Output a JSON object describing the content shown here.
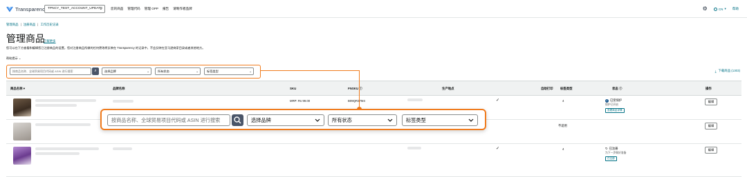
{
  "header": {
    "logo_text": "Transparency",
    "account": "TPNCY_TEST_ACCOUNT_UPDATE",
    "nav": [
      "您的商品",
      "管理代码",
      "管理 OPP",
      "报告",
      "请制作者品牌"
    ],
    "language": "CN",
    "help": "帮助"
  },
  "breadcrumb": [
    "管理商品",
    "注册商品",
    "工作历史记录"
  ],
  "page": {
    "title": "管理商品",
    "learn_more": "了解更多",
    "description": "您可以在下方查看和编辑您已注册商品的设置。您对注册商品所做的任何更改将反映在 Transparency 的记录中，不会反映在亚马逊商家目录或者其他地方。",
    "help_toggle": "帮助提示"
  },
  "filter": {
    "search_placeholder": "按商品名称、全球贸易项目代码或 ASIN 进行搜索",
    "brand": "选择品牌",
    "status": "所有状态",
    "label_type": "标签类型"
  },
  "download": "下载商品 (1303)",
  "table": {
    "columns": [
      "商品名称",
      "品牌名称",
      "SKU",
      "FNSKU",
      "生产地点",
      "自助打印",
      "标签类型",
      "状态",
      "操作"
    ],
    "rows": [
      {
        "sku": "MRP: Rs 99.00",
        "fnsku": "B09QR37M4",
        "self_print": "✓",
        "label_type": "4",
        "status_title": "已受保护",
        "status_sub": "保护已开启",
        "status_tag": "查看商品详情",
        "action": "编辑"
      },
      {
        "sku": "",
        "fnsku": "",
        "self_print": "",
        "label_type": "不适用",
        "status_title": "",
        "status_sub": "",
        "status_tag": "",
        "action": "编辑"
      },
      {
        "sku": "",
        "fnsku": "",
        "self_print": "✓",
        "label_type": "4",
        "status_title": "已注册",
        "status_sub": "为下一步做好准备",
        "status_tag": "已注册",
        "action": "编辑"
      }
    ]
  },
  "colors": {
    "accent": "#f07b1d",
    "link": "#007185",
    "button_dark": "#4a5568",
    "header_bg": "#f0f2f2"
  }
}
